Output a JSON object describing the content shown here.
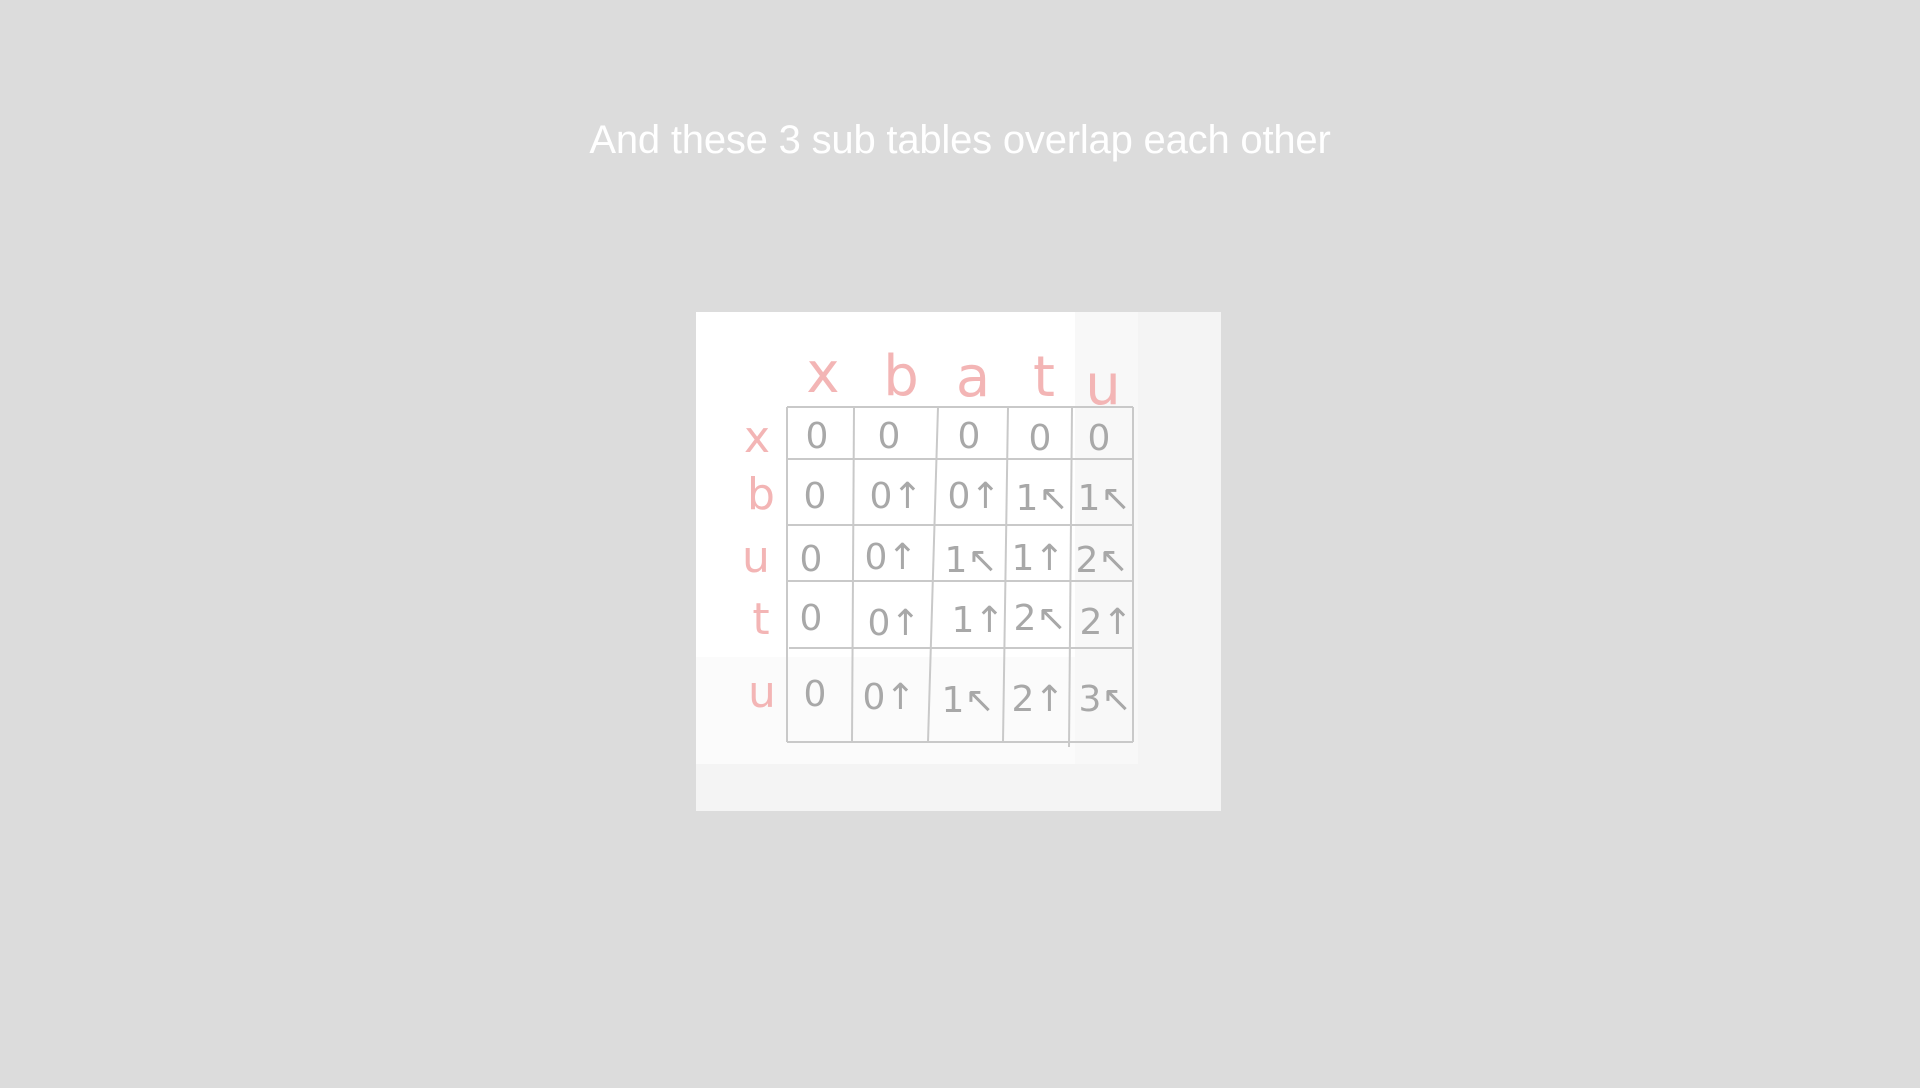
{
  "slide": {
    "title": "And these 3 sub tables overlap each other"
  },
  "table_photo": {
    "column_headers": [
      "x",
      "b",
      "a",
      "t",
      "u"
    ],
    "row_headers": [
      "x",
      "b",
      "u",
      "t",
      "u"
    ],
    "cells": [
      [
        "0",
        "0",
        "0",
        "0",
        "0"
      ],
      [
        "0",
        "0↑",
        "0↑",
        "1↖",
        "1↖"
      ],
      [
        "0",
        "0↑",
        "1↖",
        "1↑",
        "2↖"
      ],
      [
        "0",
        "0↑",
        "1↑",
        "2↖",
        "2↑"
      ],
      [
        "0",
        "0↑",
        "1↖",
        "2↑",
        "3↖"
      ]
    ],
    "colors": {
      "header_ink": "#f3b5b5",
      "grid_ink": "#c9c9c9",
      "cell_ink": "#a8a8a8"
    }
  }
}
